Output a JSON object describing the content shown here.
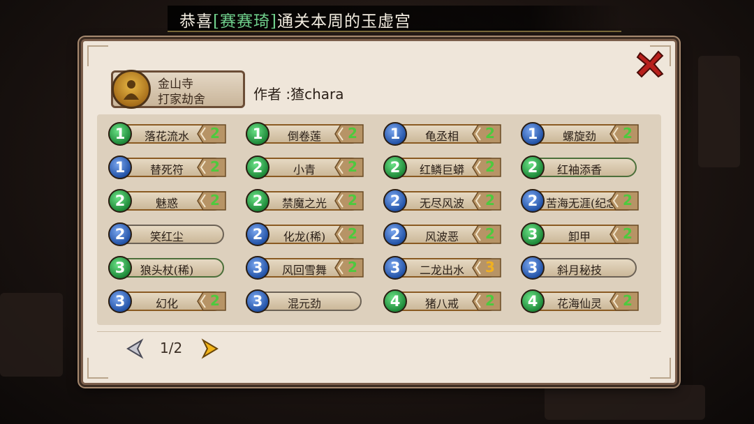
{
  "banner": {
    "prefix": "恭喜",
    "player": "[赛赛琦]",
    "suffix": "通关本周的玉虚宫"
  },
  "profile": {
    "badge_line1": "金山寺",
    "badge_line2": "打家劫舍",
    "author": "作者 :猹chara"
  },
  "cards": [
    {
      "level": "1",
      "color": "green",
      "name": "落花流水",
      "count": "2",
      "frame": "orange"
    },
    {
      "level": "1",
      "color": "green",
      "name": "倒卷莲",
      "count": "2",
      "frame": "orange"
    },
    {
      "level": "1",
      "color": "blue",
      "name": "龟丞相",
      "count": "2",
      "frame": "orange"
    },
    {
      "level": "1",
      "color": "blue",
      "name": "螺旋劲",
      "count": "2",
      "frame": "orange"
    },
    {
      "level": "1",
      "color": "blue",
      "name": "替死符",
      "count": "2",
      "frame": "orange"
    },
    {
      "level": "2",
      "color": "green",
      "name": "小青",
      "count": "2",
      "frame": "orange"
    },
    {
      "level": "2",
      "color": "green",
      "name": "红鳞巨蟒",
      "count": "2",
      "frame": "orange"
    },
    {
      "level": "2",
      "color": "green",
      "name": "红袖添香",
      "count": "",
      "frame": "green"
    },
    {
      "level": "2",
      "color": "green",
      "name": "魅惑",
      "count": "2",
      "frame": "orange"
    },
    {
      "level": "2",
      "color": "green",
      "name": "禁魔之光",
      "count": "2",
      "frame": "orange"
    },
    {
      "level": "2",
      "color": "blue",
      "name": "无尽风波",
      "count": "2",
      "frame": "orange"
    },
    {
      "level": "2",
      "color": "blue",
      "name": "苦海无涯(纪念",
      "count": "2",
      "frame": "orange"
    },
    {
      "level": "2",
      "color": "blue",
      "name": "笑红尘",
      "count": "",
      "frame": "gray"
    },
    {
      "level": "2",
      "color": "blue",
      "name": "化龙(稀)",
      "count": "2",
      "frame": "orange"
    },
    {
      "level": "2",
      "color": "blue",
      "name": "风波恶",
      "count": "2",
      "frame": "orange"
    },
    {
      "level": "3",
      "color": "green",
      "name": "卸甲",
      "count": "2",
      "frame": "orange"
    },
    {
      "level": "3",
      "color": "green",
      "name": "狼头杖(稀)",
      "count": "",
      "frame": "green"
    },
    {
      "level": "3",
      "color": "blue",
      "name": "风回雪舞",
      "count": "2",
      "frame": "orange"
    },
    {
      "level": "3",
      "color": "blue",
      "name": "二龙出水",
      "count": "3",
      "frame": "orange",
      "count_color": "yellow"
    },
    {
      "level": "3",
      "color": "blue",
      "name": "斜月秘技",
      "count": "",
      "frame": "gray"
    },
    {
      "level": "3",
      "color": "blue",
      "name": "幻化",
      "count": "2",
      "frame": "orange"
    },
    {
      "level": "3",
      "color": "blue",
      "name": "混元劲",
      "count": "",
      "frame": "gray"
    },
    {
      "level": "4",
      "color": "green",
      "name": "猪八戒",
      "count": "2",
      "frame": "orange"
    },
    {
      "level": "4",
      "color": "green",
      "name": "花海仙灵",
      "count": "2",
      "frame": "orange"
    }
  ],
  "pager": {
    "label": "1/2"
  },
  "colors": {
    "level_green": "#1f8a3a",
    "level_blue": "#2454a8",
    "count_green": "#4ec93e",
    "count_yellow": "#f0b020",
    "close_red": "#b8201c"
  },
  "icons": {
    "close": "close-icon",
    "prev": "chevron-left-icon",
    "next": "chevron-right-icon",
    "emblem": "monk-emblem-icon"
  }
}
